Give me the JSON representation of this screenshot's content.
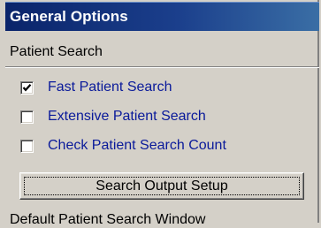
{
  "window": {
    "title": "General Options"
  },
  "patient_search": {
    "section_label": "Patient Search",
    "options": [
      {
        "label": "Fast Patient Search",
        "checked": true
      },
      {
        "label": "Extensive Patient Search",
        "checked": false
      },
      {
        "label": "Check Patient Search Count",
        "checked": false
      }
    ],
    "output_button_label": "Search Output Setup"
  },
  "next_section": {
    "label": "Default Patient Search Window"
  },
  "colors": {
    "titlebar": "#0a246a",
    "option_text": "#0a1a9a",
    "face": "#d4d0c8"
  }
}
